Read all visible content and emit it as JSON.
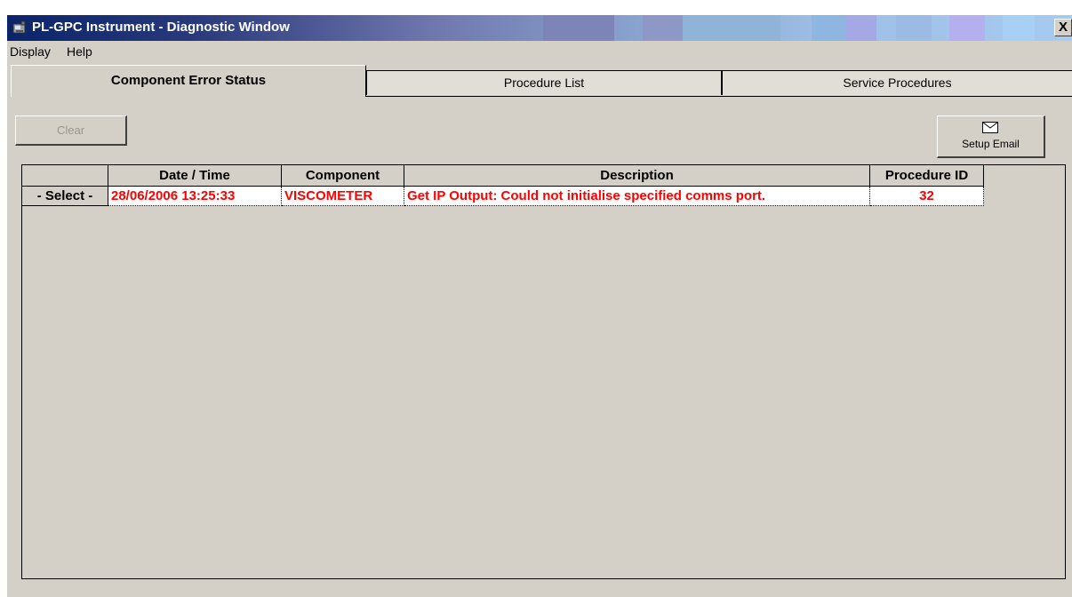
{
  "window": {
    "title": "PL-GPC Instrument - Diagnostic Window",
    "close_label": "X"
  },
  "menu": {
    "items": [
      {
        "label": "Display"
      },
      {
        "label": "Help"
      }
    ]
  },
  "tabs": [
    {
      "label": "Component Error Status",
      "active": true
    },
    {
      "label": "Procedure List",
      "active": false
    },
    {
      "label": "Service Procedures",
      "active": false
    }
  ],
  "toolbar": {
    "clear_label": "Clear",
    "clear_enabled": false,
    "email_label": "Setup Email",
    "email_icon": "envelope-icon"
  },
  "table": {
    "columns": [
      "",
      "Date / Time",
      "Component",
      "Description",
      "Procedure ID"
    ],
    "rows": [
      {
        "select_label": "- Select -",
        "datetime": "28/06/2006 13:25:33",
        "component": "VISCOMETER",
        "description": "Get IP Output: Could not initialise specified comms port.",
        "procedure_id": "32"
      }
    ]
  },
  "colors": {
    "error_text": "#ff0000",
    "title_bar": "#0a246a",
    "face": "#d4d0c8"
  }
}
